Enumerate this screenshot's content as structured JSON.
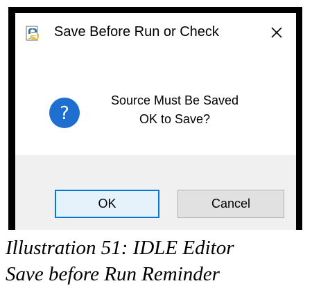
{
  "dialog": {
    "title": "Save Before Run or Check",
    "icon": "python-idle-icon",
    "close_icon": "close-icon",
    "message_icon": "question-icon",
    "message_line1": "Source Must Be Saved",
    "message_line2": "OK to Save?",
    "buttons": {
      "ok_label": "OK",
      "cancel_label": "Cancel"
    }
  },
  "caption": {
    "line1": "Illustration 51: IDLE Editor",
    "line2": "Save before Run Reminder"
  },
  "colors": {
    "accent_blue": "#0078d7",
    "question_blue": "#1e6fd0",
    "footer_bg": "#f0f0f0",
    "button_bg": "#e1e1e1",
    "frame_black": "#000000"
  }
}
